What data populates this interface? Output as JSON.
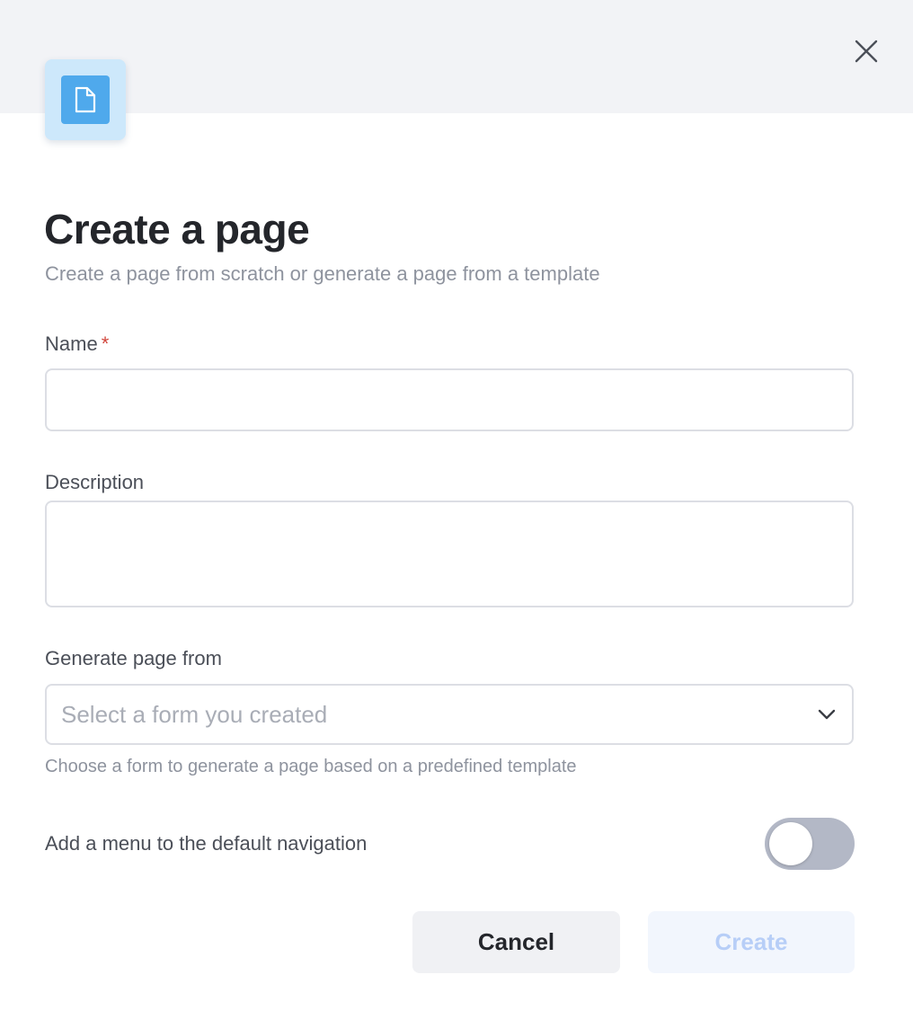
{
  "dialog": {
    "title": "Create a page",
    "subtitle": "Create a page from scratch or generate a page from a template",
    "icon": "page-icon",
    "close_icon": "close-icon"
  },
  "form": {
    "name": {
      "label": "Name",
      "required_marker": "*",
      "value": "",
      "placeholder": ""
    },
    "description": {
      "label": "Description",
      "value": "",
      "placeholder": ""
    },
    "generate_from": {
      "label": "Generate page from",
      "placeholder": "Select a form you created",
      "help": "Choose a form to generate a page based on a predefined template"
    },
    "add_menu": {
      "label": "Add a menu to the default navigation",
      "enabled": false
    }
  },
  "actions": {
    "cancel_label": "Cancel",
    "create_label": "Create"
  },
  "colors": {
    "header_band": "#f2f3f6",
    "icon_accent": "#4fa9ec",
    "required": "#d1453b",
    "create_disabled_text": "#b7cef7"
  }
}
